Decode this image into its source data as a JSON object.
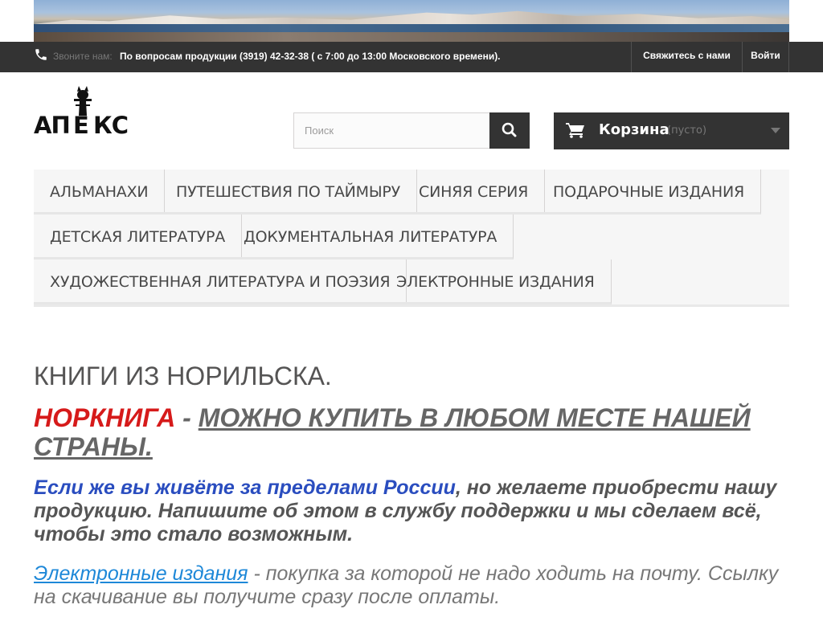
{
  "topbar": {
    "phone_hint": "Звоните нам:",
    "phone_text": "По вопросам продукции (3919) 42-32-38 ( с 7:00 до 13:00 Московского времени).",
    "contact_label": "Свяжитесь с нами",
    "login_label": "Войти",
    "icon": "phone-icon"
  },
  "logo": {
    "text": "АПЕКС"
  },
  "search": {
    "placeholder": "Поиск",
    "icon": "search-icon"
  },
  "cart": {
    "label": "Корзина",
    "status": "(пусто)",
    "icon": "cart-icon"
  },
  "menu": {
    "items": [
      "АЛЬМАНАХИ",
      "ПУТЕШЕСТВИЯ ПО ТАЙМЫРУ",
      "СИНЯЯ СЕРИЯ",
      "ПОДАРОЧНЫЕ ИЗДАНИЯ",
      "ДЕТСКАЯ ЛИТЕРАТУРА",
      "ДОКУМЕНТАЛЬНАЯ ЛИТЕРАТУРА",
      "ХУДОЖЕСТВЕННАЯ ЛИТЕРАТУРА И ПОЭЗИЯ",
      "ЭЛЕКТРОННЫЕ ИЗДАНИЯ"
    ]
  },
  "content": {
    "heading": "КНИГИ ИЗ НОРИЛЬСКА.",
    "brand": "НОРКНИГА",
    "separator": " -  ",
    "brand_link": "МОЖНО КУПИТЬ В ЛЮБОМ МЕСТЕ НАШЕЙ СТРАНЫ.",
    "abroad_highlight": "Если же вы живёте за пределами России",
    "abroad_rest": ", но желаете приобрести нашу продукцию. Напишите об этом в службу поддержки и мы сделаем всё, чтобы это стало возможным.",
    "ebooks_link": "Электронные издания",
    "ebooks_rest": " - покупка за которой не надо ходить на почту. Ссылку на скачивание вы получите сразу после оплаты."
  },
  "colors": {
    "dark_bar": "#333333",
    "brand_red": "#d61a1a",
    "highlight_blue": "#2a4dbf",
    "link_blue": "#1e88d8"
  }
}
